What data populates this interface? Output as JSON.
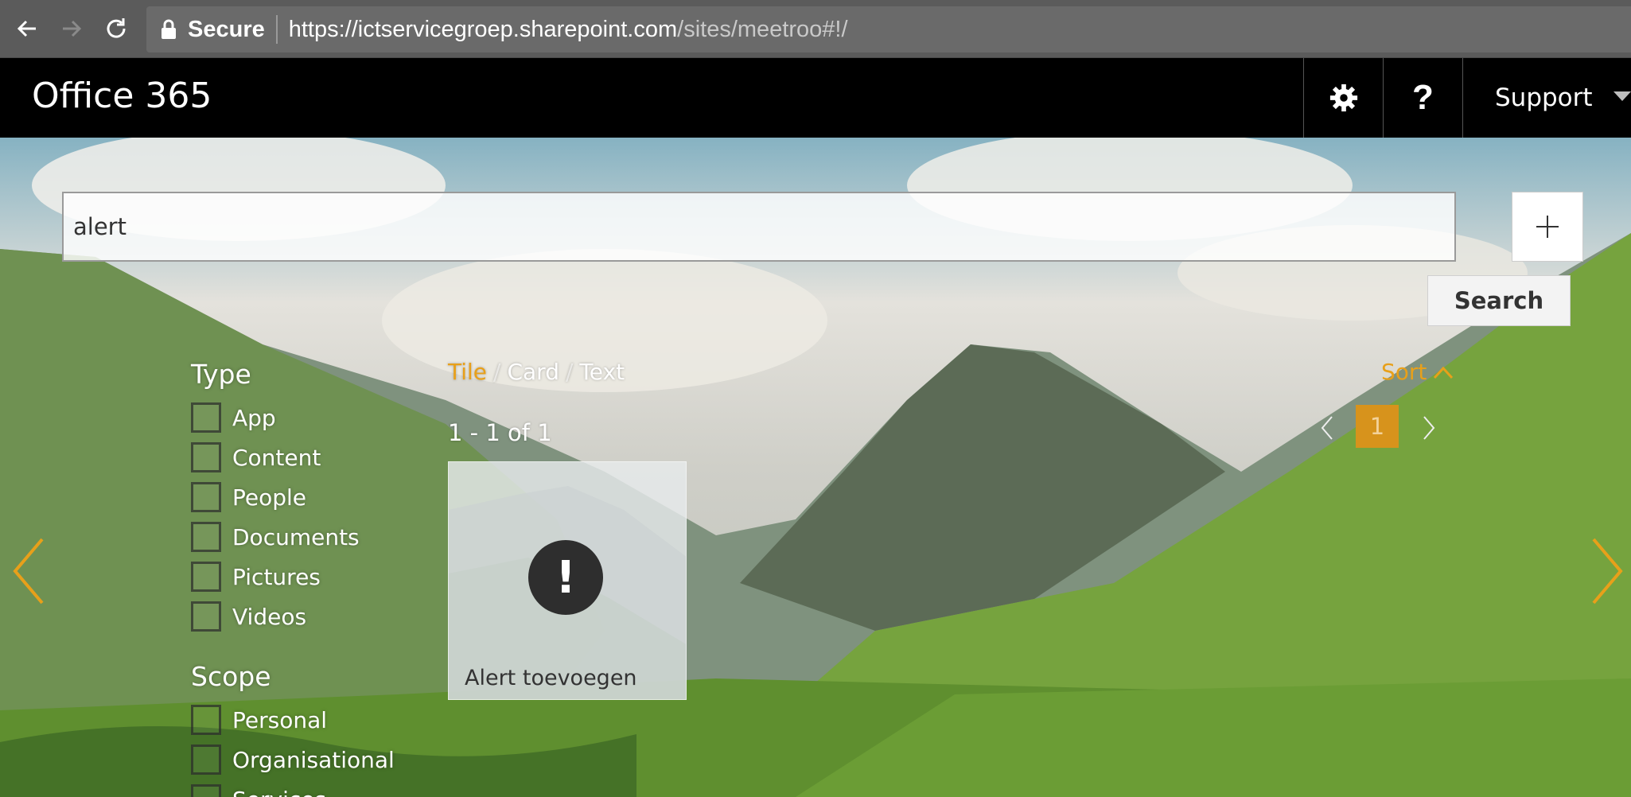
{
  "browser": {
    "secure_label": "Secure",
    "url_host": "https://ictservicegroep.sharepoint.com",
    "url_path": "/sites/meetroo#!/"
  },
  "topbar": {
    "brand": "Office 365",
    "support_label": "Support"
  },
  "search": {
    "value": "alert",
    "button_label": "Search"
  },
  "filters": {
    "type_title": "Type",
    "type_items": [
      "App",
      "Content",
      "People",
      "Documents",
      "Pictures",
      "Videos"
    ],
    "scope_title": "Scope",
    "scope_items": [
      "Personal",
      "Organisational",
      "Services"
    ]
  },
  "view": {
    "tabs": [
      "Tile",
      "Card",
      "Text"
    ],
    "active_tab": "Tile",
    "result_count": "1 - 1 of 1"
  },
  "results": [
    {
      "icon": "exclamation-icon",
      "title": "Alert toevoegen"
    }
  ],
  "sort": {
    "label": "Sort"
  },
  "pagination": {
    "current_page": "1"
  },
  "colors": {
    "accent": "#e8a01a",
    "page_active": "#d7931c"
  }
}
